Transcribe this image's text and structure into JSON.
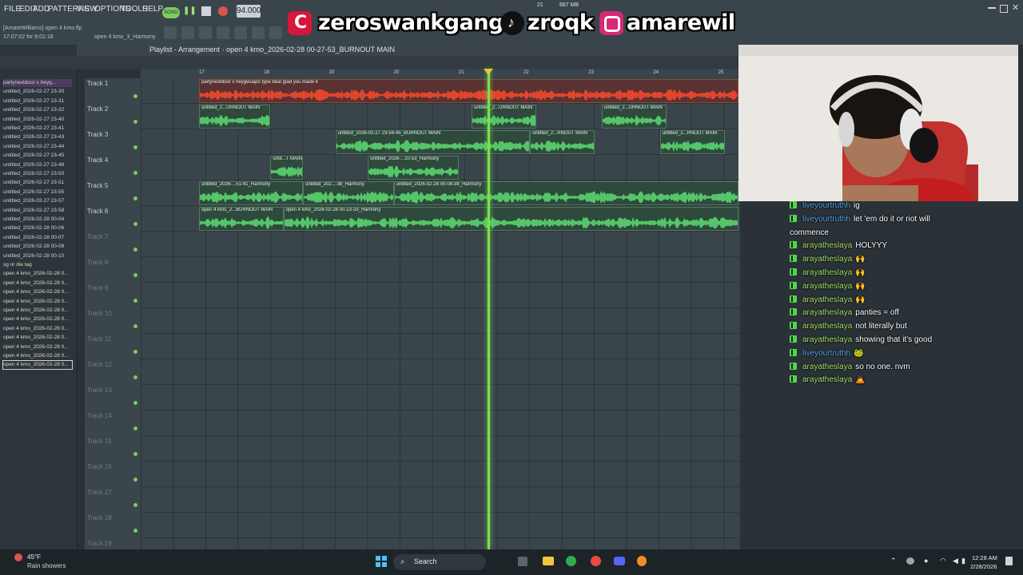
{
  "menu": [
    "FILE",
    "EDIT",
    "ADD",
    "PATTERNS",
    "VIEW",
    "OPTIONS",
    "TOOLS",
    "HELP"
  ],
  "project": {
    "user_line": "[AmareWilliams]  open 4 kmo.flp",
    "time_line": "17:07:02 for 8:01:18",
    "hint_line": "open 4 kmo_3_Harmony"
  },
  "transport": {
    "song_label": "SONG",
    "tempo": "94.000",
    "cpu": "21",
    "mem": "687 MB"
  },
  "social": {
    "handle1": "zeroswankgang",
    "handle2": "zroqk",
    "handle3": "amarewil",
    "colors": {
      "cashapp": "#d6163c",
      "tiktok": "#111111",
      "instagram": "#d62976"
    }
  },
  "browser": {
    "items": [
      "partynextdoor x heyg...",
      "untitled_2026-02-27 23-30",
      "untitled_2026-02-27 23-31",
      "untitled_2026-02-27 23-32",
      "untitled_2026-02-27 23-40",
      "untitled_2026-02-27 23-41",
      "untitled_2026-02-27 23-43",
      "untitled_2026-02-27 23-44",
      "untitled_2026-02-27 23-45",
      "untitled_2026-02-27 23-48",
      "untitled_2026-02-27 23-50",
      "untitled_2026-02-27 23-51",
      "untitled_2026-02-27 23-55",
      "untitled_2026-02-27 23-57",
      "untitled_2026-02-27 23-58",
      "untitled_2026-02-28 00-04",
      "untitled_2026-02-28 00-06",
      "untitled_2026-02-28 00-07",
      "untitled_2026-02-28 00-08",
      "untitled_2026-02-28 00-10",
      "sg or die tag",
      "open 4 kmo_2026-02-28 0...",
      "open 4 kmo_2026-02-28 0...",
      "open 4 kmo_2026-02-28 0...",
      "open 4 kmo_2026-02-28 0...",
      "open 4 kmo_2026-02-28 0...",
      "open 4 kmo_2026-02-28 0...",
      "open 4 kmo_2026-02-28 0...",
      "open 4 kmo_2026-02-28 0...",
      "open 4 kmo_2026-02-28 0...",
      "open 4 kmo_2026-02-28 0...",
      "open 4 kmo_2026-02-28 0..."
    ]
  },
  "playlist": {
    "title": "Playlist - Arrangement",
    "breadcrumb": "open 4 kmo_2026-02-28 00-27-53_BURNOUT MAIN",
    "ruler": [
      "17",
      "18",
      "19",
      "20",
      "21",
      "22",
      "23",
      "24",
      "25"
    ],
    "tracks": [
      "Track 1",
      "Track 2",
      "Track 3",
      "Track 4",
      "Track 5",
      "Track 6",
      "Track 7",
      "Track 8",
      "Track 9",
      "Track 10",
      "Track 11",
      "Track 12",
      "Track 13",
      "Track 14",
      "Track 15",
      "Track 16",
      "Track 17",
      "Track 18",
      "Track 19"
    ],
    "clips": [
      {
        "label": "partynextdoor x heygwuapo type beat glad you made it",
        "track": 0,
        "start": 17.0,
        "end": 26.0,
        "kind": "red"
      },
      {
        "label": "untitled_2...URNOUT MAIN",
        "track": 1,
        "start": 17.0,
        "end": 18.1,
        "kind": "green"
      },
      {
        "label": "untitled_2...URNOUT MAIN",
        "track": 1,
        "start": 21.2,
        "end": 22.2,
        "kind": "green"
      },
      {
        "label": "untitled_2...URNOUT MAIN",
        "track": 1,
        "start": 23.2,
        "end": 24.2,
        "kind": "green"
      },
      {
        "label": "untitled_2026-02-27 23-56-45_BURNOUT MAIN",
        "track": 2,
        "start": 19.1,
        "end": 22.1,
        "kind": "green"
      },
      {
        "label": "untitled_2...RNOUT MAIN",
        "track": 2,
        "start": 22.1,
        "end": 23.1,
        "kind": "green"
      },
      {
        "label": "untitled_2...RNOUT MAIN",
        "track": 2,
        "start": 24.1,
        "end": 25.1,
        "kind": "green"
      },
      {
        "label": "untit...T MAIN",
        "track": 3,
        "start": 18.1,
        "end": 18.6,
        "kind": "green"
      },
      {
        "label": "untitled_2026-...10-53_Harmony",
        "track": 3,
        "start": 19.6,
        "end": 21.0,
        "kind": "green"
      },
      {
        "label": "untitled_2026-...51-41_Harmony",
        "track": 4,
        "start": 17.0,
        "end": 18.6,
        "kind": "green"
      },
      {
        "label": "untitled_202...-38_Harmony",
        "track": 4,
        "start": 18.6,
        "end": 20.0,
        "kind": "green"
      },
      {
        "label": "untitled_2026-02-28 00-08-38_Harmony",
        "track": 4,
        "start": 20.0,
        "end": 26.0,
        "kind": "green"
      },
      {
        "label": "open 4 kmo_2...BURNOUT MAIN",
        "track": 5,
        "start": 17.0,
        "end": 18.3,
        "kind": "green"
      },
      {
        "label": "open 4 kmo_2026-02-28 00-23-33_Harmony",
        "track": 5,
        "start": 18.3,
        "end": 26.0,
        "kind": "green"
      }
    ],
    "playhead_bar": 21.45
  },
  "chat": [
    {
      "user": "liveyourtruthh",
      "msg": "ig",
      "color": "blue"
    },
    {
      "user": "liveyourtruthh",
      "msg": "let 'em do it or riot will",
      "color": "blue"
    },
    {
      "user": "",
      "msg": "commence",
      "color": "none"
    },
    {
      "user": "arayatheslaya",
      "msg": "HOLYYY",
      "color": "green"
    },
    {
      "user": "arayatheslaya",
      "msg": "🙌",
      "color": "green"
    },
    {
      "user": "arayatheslaya",
      "msg": "🙌",
      "color": "green"
    },
    {
      "user": "arayatheslaya",
      "msg": "🙌",
      "color": "green"
    },
    {
      "user": "arayatheslaya",
      "msg": "🙌",
      "color": "green"
    },
    {
      "user": "arayatheslaya",
      "msg": "panties = off",
      "color": "green"
    },
    {
      "user": "arayatheslaya",
      "msg": "not literally but",
      "color": "green"
    },
    {
      "user": "arayatheslaya",
      "msg": "showing that it's good",
      "color": "green"
    },
    {
      "user": "liveyourtruthh",
      "msg": "🐸",
      "color": "blue"
    },
    {
      "user": "arayatheslaya",
      "msg": "so no one. nvm",
      "color": "green"
    },
    {
      "user": "arayatheslaya",
      "msg": "🙇",
      "color": "green"
    }
  ],
  "taskbar": {
    "weather_temp": "45°F",
    "weather_desc": "Rain showers",
    "search": "Search",
    "time": "12:28 AM",
    "date": "2/28/2026"
  }
}
